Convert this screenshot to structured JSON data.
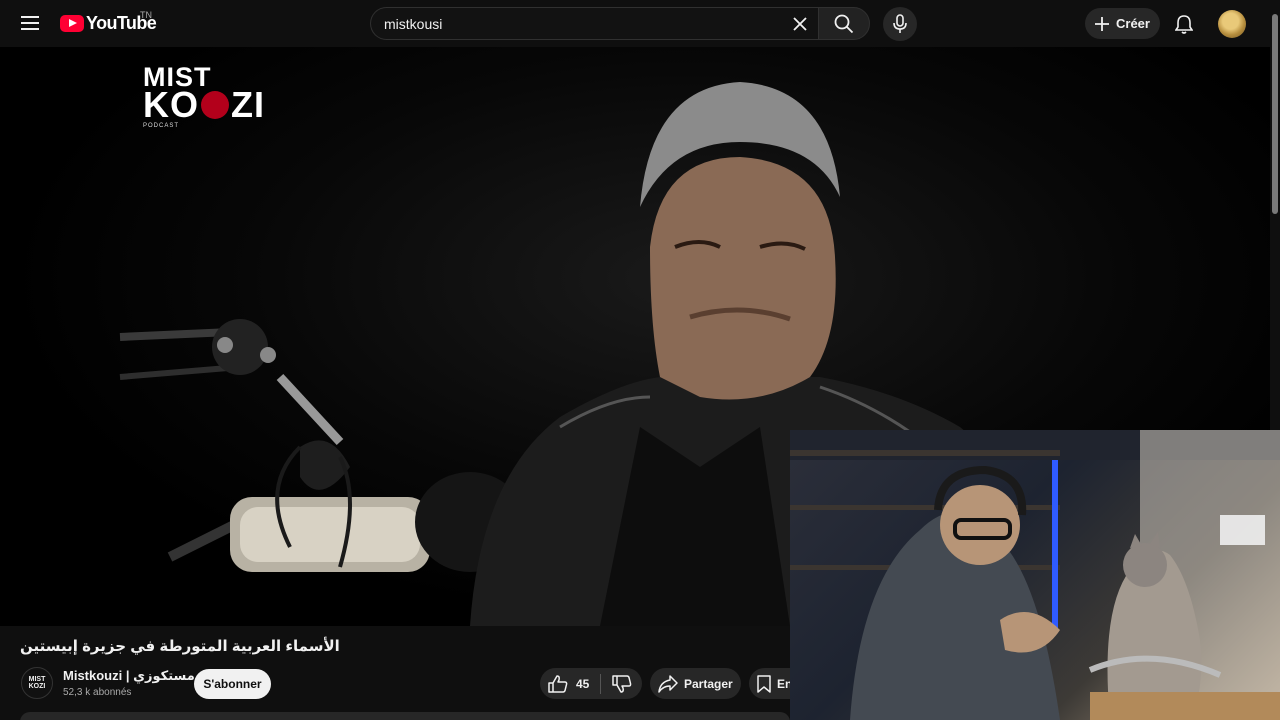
{
  "header": {
    "logo_text": "YouTube",
    "country_code": "TN",
    "search_query": "mistkousi",
    "create_label": "Créer"
  },
  "video": {
    "brand_line1": "MIST",
    "brand_line2_left": "KO",
    "brand_line2_right": "ZI",
    "brand_sub": "PODCAST",
    "title": "الأسماء العربية المتورطة في جزيرة إبيستين"
  },
  "channel": {
    "avatar_line1": "MIST",
    "avatar_line2": "KOZI",
    "name": "Mistkouzi | مستكوزي",
    "subscribers": "52,3 k abonnés",
    "subscribe_label": "S'abonner"
  },
  "actions": {
    "likes": "45",
    "share_label": "Partager",
    "save_label": "En"
  },
  "colors": {
    "background": "#0f0f0f",
    "brand_red": "#ff0033",
    "button_bg": "#272727"
  }
}
